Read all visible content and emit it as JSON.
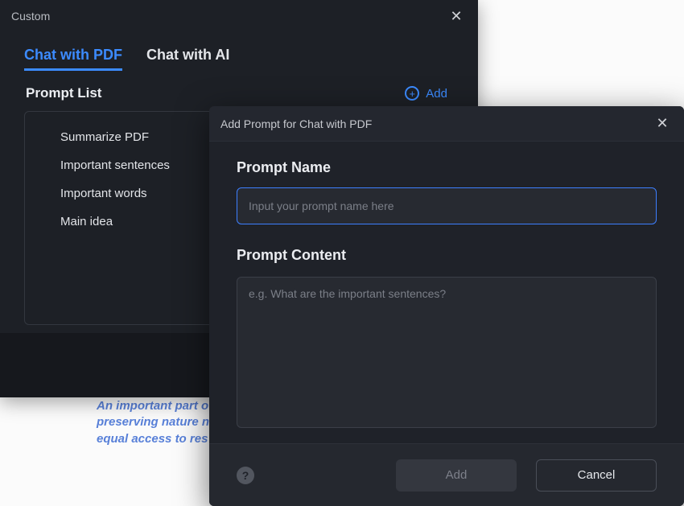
{
  "background_doc": {
    "line1": "An important part o",
    "line2": "preserving nature n",
    "line3": "equal access to res"
  },
  "custom_panel": {
    "title": "Custom",
    "tabs": [
      {
        "label": "Chat with PDF",
        "active": true
      },
      {
        "label": "Chat with AI",
        "active": false
      }
    ],
    "list_title": "Prompt List",
    "add_label": "Add",
    "items": [
      "Summarize PDF",
      "Important sentences",
      "Important words",
      "Main idea"
    ]
  },
  "add_dialog": {
    "title": "Add Prompt for Chat with PDF",
    "name_label": "Prompt Name",
    "name_placeholder": "Input your prompt name here",
    "name_value": "",
    "content_label": "Prompt Content",
    "content_placeholder": "e.g. What are the important sentences?",
    "content_value": "",
    "add_button": "Add",
    "cancel_button": "Cancel"
  },
  "icons": {
    "close": "✕",
    "plus": "+",
    "help": "?"
  }
}
